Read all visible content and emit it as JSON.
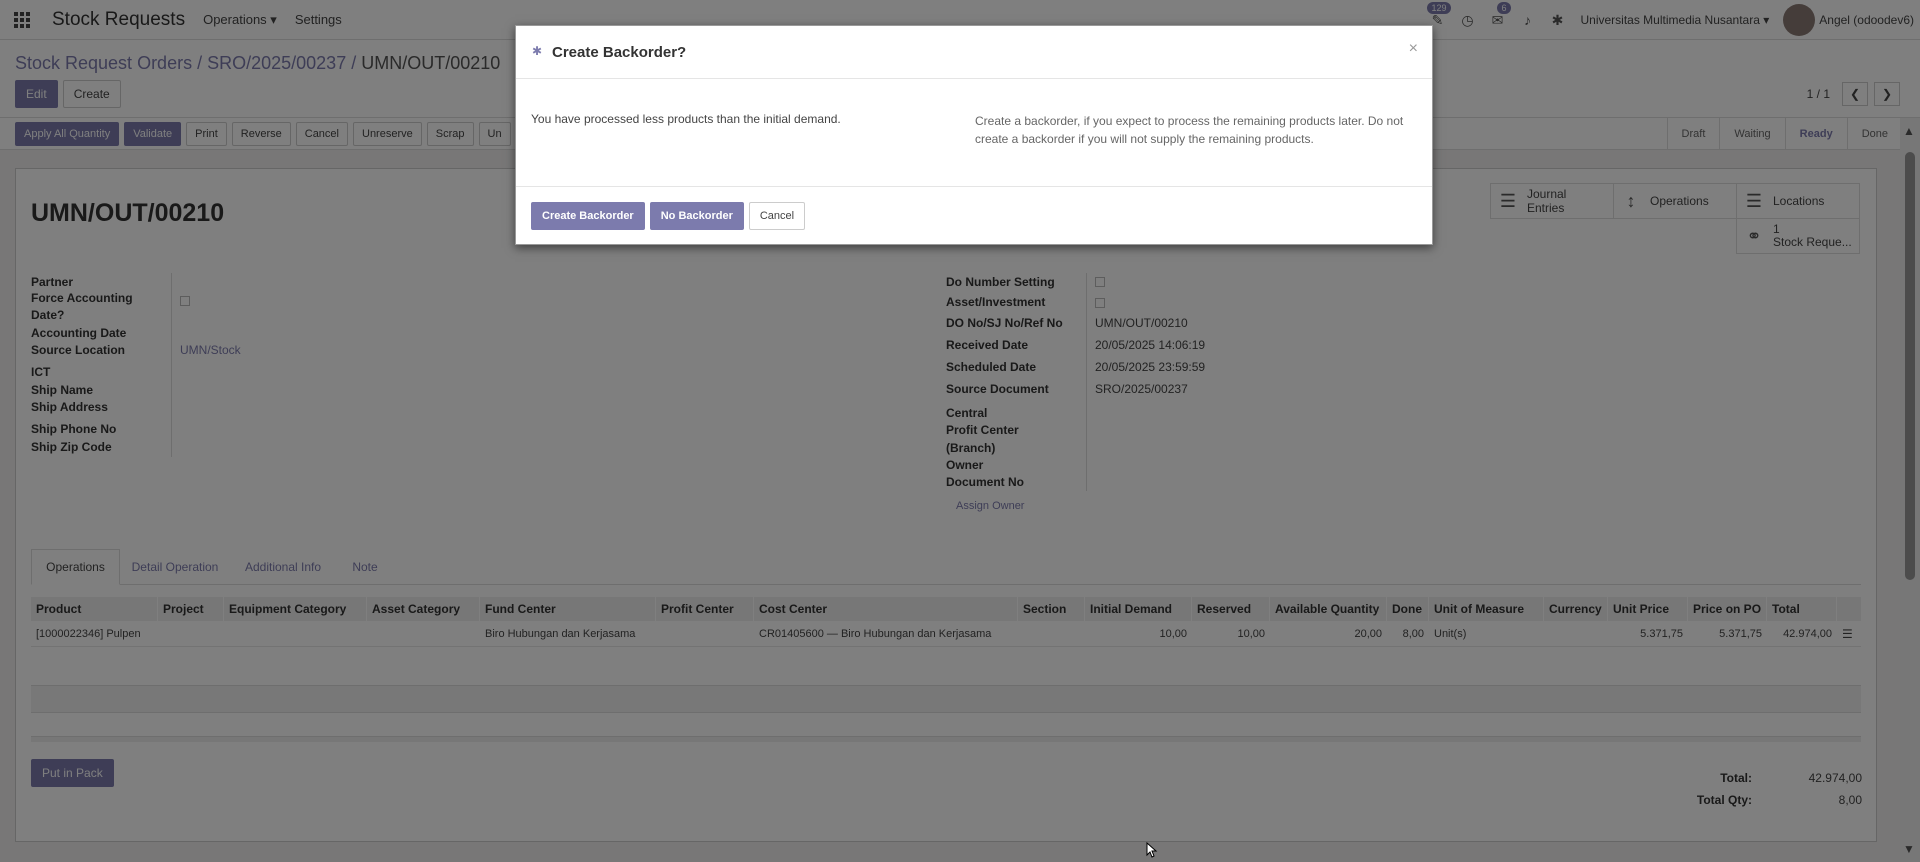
{
  "navbar": {
    "app_title": "Stock Requests",
    "menus": [
      "Operations",
      "Settings"
    ],
    "badges": {
      "activity": "129",
      "messages": "6"
    },
    "company": "Universitas Multimedia Nusantara",
    "user": "Angel (odoodev6)"
  },
  "control": {
    "breadcrumb": [
      "Stock Request Orders",
      "SRO/2025/00237",
      "UMN/OUT/00210"
    ],
    "edit_label": "Edit",
    "create_label": "Create",
    "pager": "1 / 1"
  },
  "statusbar": {
    "actions": [
      "Apply All Quantity",
      "Validate",
      "Print",
      "Reverse",
      "Cancel",
      "Unreserve",
      "Scrap",
      "Un"
    ],
    "stages": [
      "Draft",
      "Waiting",
      "Ready",
      "Done"
    ],
    "active_stage": "Ready"
  },
  "form": {
    "title": "UMN/OUT/00210",
    "smart_buttons": {
      "journal_entries": "Journal Entries",
      "operations": "Operations",
      "locations": "Locations",
      "stock_request_count": "1",
      "stock_request_label": "Stock Reque..."
    },
    "left_fields": {
      "partner": "Partner",
      "force_accounting_1": "Force Accounting",
      "force_accounting_2": "Date?",
      "accounting_date": "Accounting Date",
      "source_location": "Source Location",
      "source_location_val": "UMN/Stock",
      "ict": "ICT",
      "ship_name": "Ship Name",
      "ship_address": "Ship Address",
      "ship_phone": "Ship Phone No",
      "ship_zip": "Ship Zip Code"
    },
    "right_fields": {
      "do_number_setting": "Do Number Setting",
      "asset_investment": "Asset/Investment",
      "do_no": "DO No/SJ No/Ref No",
      "do_no_val": "UMN/OUT/00210",
      "received_date": "Received Date",
      "received_date_val": "20/05/2025 14:06:19",
      "scheduled_date": "Scheduled Date",
      "scheduled_date_val": "20/05/2025 23:59:59",
      "source_document": "Source Document",
      "source_document_val": "SRO/2025/00237",
      "central": "Central",
      "profit_center": "Profit Center",
      "branch": "(Branch)",
      "owner": "Owner",
      "document_no": "Document No",
      "assign_owner": "Assign Owner"
    },
    "tabs": [
      "Operations",
      "Detail Operation",
      "Additional Info",
      "Note"
    ],
    "table": {
      "headers": [
        "Product",
        "Project",
        "Equipment Category",
        "Asset Category",
        "Fund Center",
        "Profit Center",
        "Cost Center",
        "Section",
        "Initial Demand",
        "Reserved",
        "Available Quantity",
        "Done",
        "Unit of Measure",
        "Currency",
        "Unit Price",
        "Price on PO",
        "Total"
      ],
      "row": {
        "product": "[1000022346] Pulpen",
        "project": "",
        "equipment_category": "",
        "asset_category": "",
        "fund_center": "Biro Hubungan dan Kerjasama",
        "profit_center": "",
        "cost_center": "CR01405600 — Biro Hubungan dan Kerjasama",
        "section": "",
        "initial_demand": "10,00",
        "reserved": "10,00",
        "available_quantity": "20,00",
        "done": "8,00",
        "uom": "Unit(s)",
        "currency": "",
        "unit_price": "5.371,75",
        "price_on_po": "5.371,75",
        "total": "42.974,00"
      }
    },
    "put_in_pack": "Put in Pack",
    "totals": {
      "total_label": "Total:",
      "total_val": "42.974,00",
      "total_qty_label": "Total Qty:",
      "total_qty_val": "8,00"
    }
  },
  "modal": {
    "title": "Create Backorder?",
    "message_left": "You have processed less products than the initial demand.",
    "message_right": "Create a backorder, if you expect to process the remaining products later. Do not create a backorder if you will not supply the remaining products.",
    "create_backorder": "Create Backorder",
    "no_backorder": "No Backorder",
    "cancel": "Cancel"
  },
  "colors": {
    "primary": "#7c7bad",
    "overlay": "rgba(0,0,0,0.5)"
  }
}
